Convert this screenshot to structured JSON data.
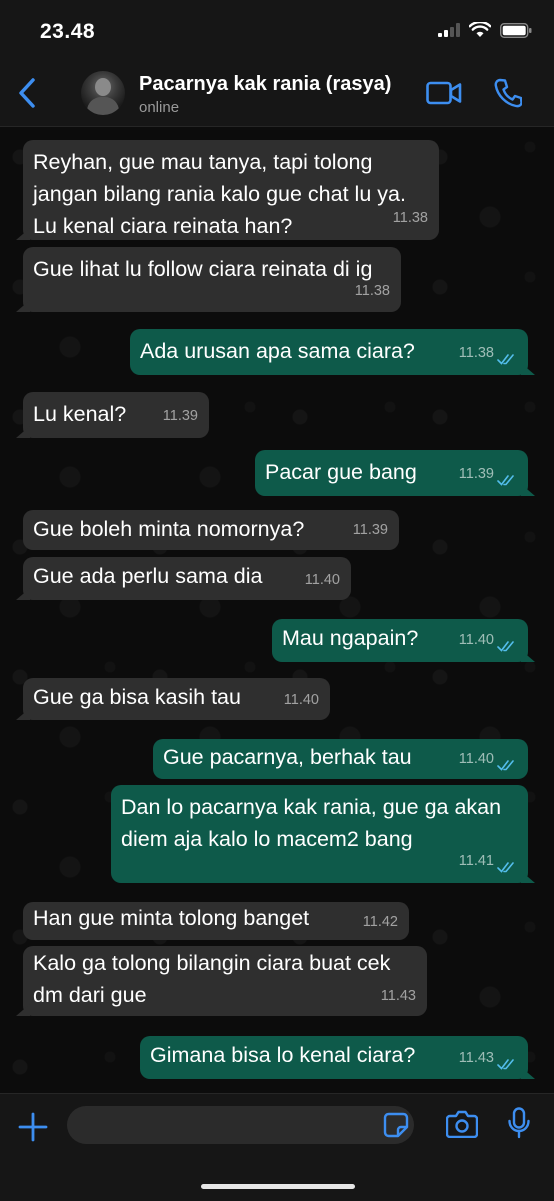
{
  "status_bar": {
    "time": "23.48"
  },
  "header": {
    "contact_name": "Pacarnya kak rania (rasya)",
    "contact_status": "online"
  },
  "colors": {
    "accent": "#3d8ef0",
    "incoming_bubble": "#2f2f2f",
    "outgoing_bubble": "#0e5a4a",
    "read_ticks": "#53bdeb"
  },
  "messages": [
    {
      "direction": "in",
      "text": "Reyhan, gue mau tanya, tapi tolong\njangan bilang rania kalo gue chat lu ya.\nLu kenal ciara reinata han?",
      "time": "11.38"
    },
    {
      "direction": "in",
      "text": "Gue lihat lu follow ciara reinata di ig",
      "time": "11.38"
    },
    {
      "direction": "out",
      "text": "Ada urusan apa sama ciara?",
      "time": "11.38",
      "status": "read"
    },
    {
      "direction": "in",
      "text": "Lu kenal?",
      "time": "11.39"
    },
    {
      "direction": "out",
      "text": "Pacar gue bang",
      "time": "11.39",
      "status": "read"
    },
    {
      "direction": "in",
      "text": "Gue boleh minta nomornya?",
      "time": "11.39"
    },
    {
      "direction": "in",
      "text": "Gue ada perlu sama dia",
      "time": "11.40"
    },
    {
      "direction": "out",
      "text": "Mau ngapain?",
      "time": "11.40",
      "status": "read"
    },
    {
      "direction": "in",
      "text": "Gue ga bisa kasih tau",
      "time": "11.40"
    },
    {
      "direction": "out",
      "text": "Gue pacarnya, berhak tau",
      "time": "11.40",
      "status": "read"
    },
    {
      "direction": "out",
      "text": "Dan lo pacarnya kak rania, gue ga akan\ndiem aja kalo lo macem2 bang",
      "time": "11.41",
      "status": "read"
    },
    {
      "direction": "in",
      "text": "Han gue minta tolong banget",
      "time": "11.42"
    },
    {
      "direction": "in",
      "text": "Kalo ga tolong bilangin ciara buat cek\ndm dari gue",
      "time": "11.43"
    },
    {
      "direction": "out",
      "text": "Gimana bisa lo kenal ciara?",
      "time": "11.43",
      "status": "read"
    }
  ],
  "input_bar": {
    "placeholder": ""
  },
  "icons": {
    "back": "chevron-left-icon",
    "video": "video-camera-icon",
    "call": "phone-icon",
    "add": "plus-icon",
    "sticker": "sticker-icon",
    "camera": "camera-icon",
    "mic": "microphone-icon"
  }
}
